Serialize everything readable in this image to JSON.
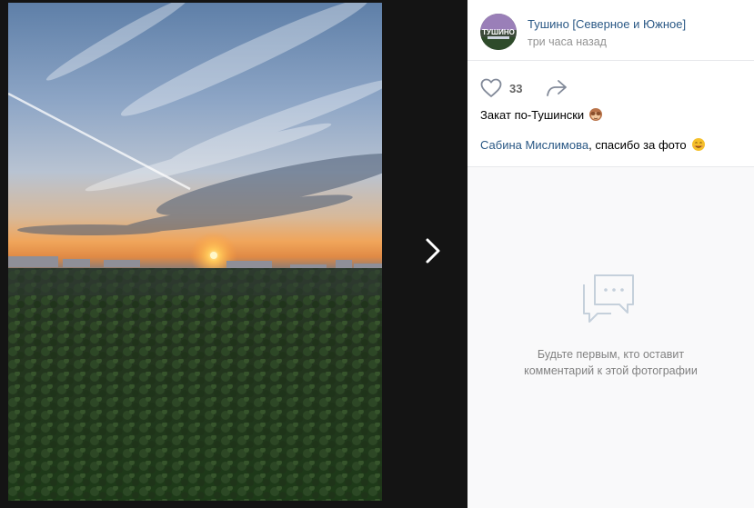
{
  "author": {
    "name": "Тушино [Северное и Южное]",
    "avatar_text": "ТУШИНО",
    "time": "три часа назад"
  },
  "likes": {
    "count": "33"
  },
  "caption": {
    "text": "Закат по-Тушински",
    "emoji": "see-no-evil-monkey"
  },
  "mention": {
    "name": "Сабина Мислимова",
    "rest": ", спасибо за фото",
    "emoji": "smiling-face"
  },
  "comments": {
    "empty_line1": "Будьте первым, кто оставит",
    "empty_line2": "комментарий к этой фотографии"
  },
  "colors": {
    "link": "#2a5885",
    "muted": "#939393",
    "icon": "#828a99"
  }
}
